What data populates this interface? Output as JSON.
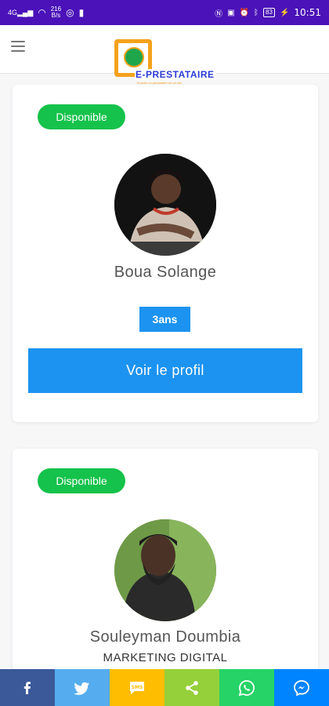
{
  "status_bar": {
    "signal": "4G",
    "net_speed_value": "216",
    "net_speed_unit": "B/s",
    "battery": "83",
    "time": "10:51"
  },
  "header": {
    "logo_text": "E-PRESTATAIRE",
    "logo_tagline": "Trouvez un prestataire en un clic"
  },
  "cards": [
    {
      "status": "Disponible",
      "name": "Boua Solange",
      "experience": "3ans",
      "button": "Voir le profil"
    },
    {
      "status": "Disponible",
      "name": "Souleyman Doumbia",
      "specialty": "MARKETING DIGITAL"
    }
  ],
  "share_bar": [
    {
      "icon": "facebook-icon",
      "color": "#3b5998"
    },
    {
      "icon": "twitter-icon",
      "color": "#55acee"
    },
    {
      "icon": "sms-icon",
      "color": "#ffbd00"
    },
    {
      "icon": "share-icon",
      "color": "#95d03a"
    },
    {
      "icon": "whatsapp-icon",
      "color": "#25d366"
    },
    {
      "icon": "messenger-icon",
      "color": "#0084ff"
    }
  ],
  "colors": {
    "status_bar": "#4a12b8",
    "available_badge": "#15c24b",
    "primary": "#1c93f0"
  }
}
